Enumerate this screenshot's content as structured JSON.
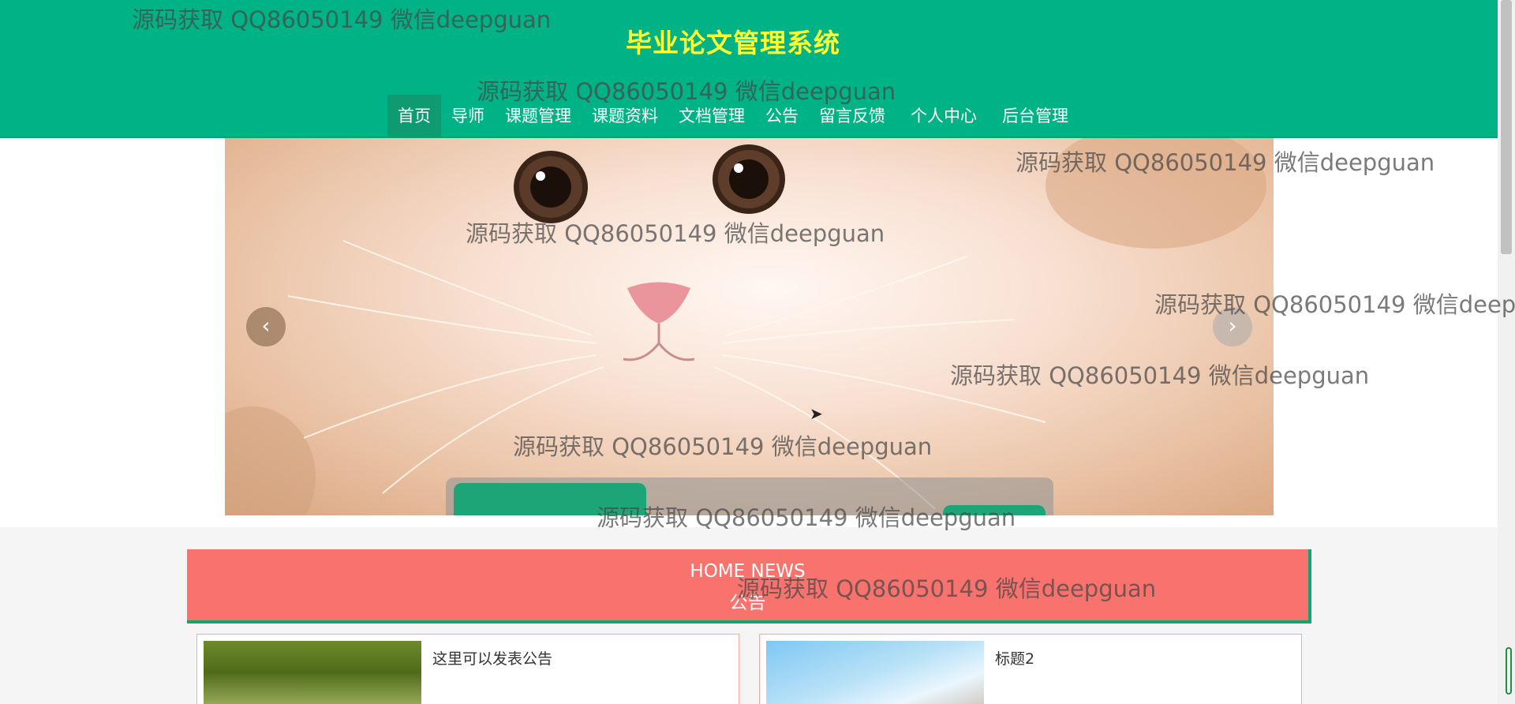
{
  "header": {
    "title": "毕业论文管理系统"
  },
  "nav": {
    "items": [
      {
        "label": "首页",
        "active": true
      },
      {
        "label": "导师"
      },
      {
        "label": "课题管理"
      },
      {
        "label": "课题资料"
      },
      {
        "label": "文档管理"
      },
      {
        "label": "公告"
      },
      {
        "label": "留言反馈"
      },
      {
        "label": "个人中心"
      },
      {
        "label": "后台管理"
      }
    ]
  },
  "banner": {
    "prev_icon": "‹",
    "next_icon": "›"
  },
  "news": {
    "title_en": "HOME NEWS",
    "title_cn": "公告"
  },
  "cards": [
    {
      "title": "这里可以发表公告"
    },
    {
      "title": "标题2"
    }
  ],
  "watermark": "源码获取 QQ86050149 微信deepguan",
  "colors": {
    "accent": "#00b386",
    "title": "#ffff33",
    "news": "#f8736d"
  }
}
